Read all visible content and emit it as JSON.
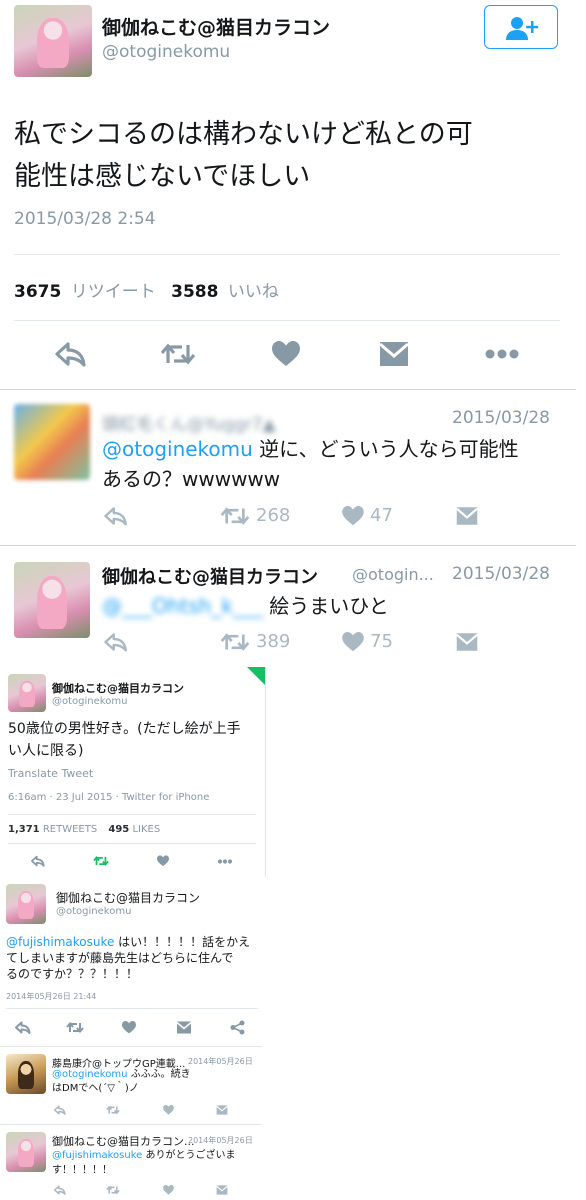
{
  "main_tweet": {
    "name": "御伽ねこむ@猫目カラコン",
    "handle": "@otoginekomu",
    "text_line1": "私でシコるのは構わないけど私との可",
    "text_line2": "能性は感じないでほしい",
    "timestamp": "2015/03/28 2:54",
    "retweet_count": "3675",
    "retweet_label": "リツイート",
    "like_count": "3588",
    "like_label": "いいね"
  },
  "reply1": {
    "name_blurred": "頭紅毛くん@Yuggr7▲",
    "date": "2015/03/28",
    "mention": "@otoginekomu",
    "text_line1": " 逆に、どういう人なら可能性",
    "text_line2": "あるの？wwwwww",
    "retweets": "268",
    "likes": "47"
  },
  "reply2": {
    "name": "御伽ねこむ@猫目カラコン",
    "handle": "@otogin...",
    "date": "2015/03/28",
    "mention_blurred": "@___Ohtsh_k___",
    "text": "絵うまいひと",
    "retweets": "389",
    "likes": "75"
  },
  "embed1": {
    "name": "御伽ねこむ@猫目カラコン",
    "handle": "@otoginekomu",
    "text_line1": "50歳位の男性好き。(ただし絵が上手",
    "text_line2": "い人に限る)",
    "translate": "Translate Tweet",
    "meta": "6:16am · 23 Jul 2015 · Twitter for iPhone",
    "retweets_num": "1,371",
    "retweets_label": "RETWEETS",
    "likes_num": "495",
    "likes_label": "LIKES"
  },
  "embed2": {
    "name": "御伽ねこむ@猫目カラコン",
    "handle": "@otoginekomu",
    "mention": "@fujishimakosuke",
    "text_line1": " はい！！！！！話をかえ",
    "text_line2": "てしまいますが藤島先生はどちらに住んで",
    "text_line3": "るのですか？？？！！！",
    "date": "2014年05月26日 21:44"
  },
  "embed3": {
    "name": "藤島康介@トップウGP連載...",
    "date": "2014年05月26日",
    "mention": "@otoginekomu",
    "text_line1": " ふふふ。続き",
    "text_line2": "はDMでヘ(´▽｀)ノ"
  },
  "embed4": {
    "name": "御伽ねこむ@猫目カラコン...",
    "date": "2014年05月26日",
    "mention": "@fujishimakosuke",
    "text_line1": " ありがとうございま",
    "text_line2": "す！！！！！"
  },
  "colors": {
    "accent": "#1da1f2",
    "muted": "#8899a6",
    "green": "#17bf63"
  },
  "icons": [
    "follow-user-icon",
    "reply-icon",
    "retweet-icon",
    "like-icon",
    "dm-icon",
    "more-icon",
    "share-icon"
  ]
}
